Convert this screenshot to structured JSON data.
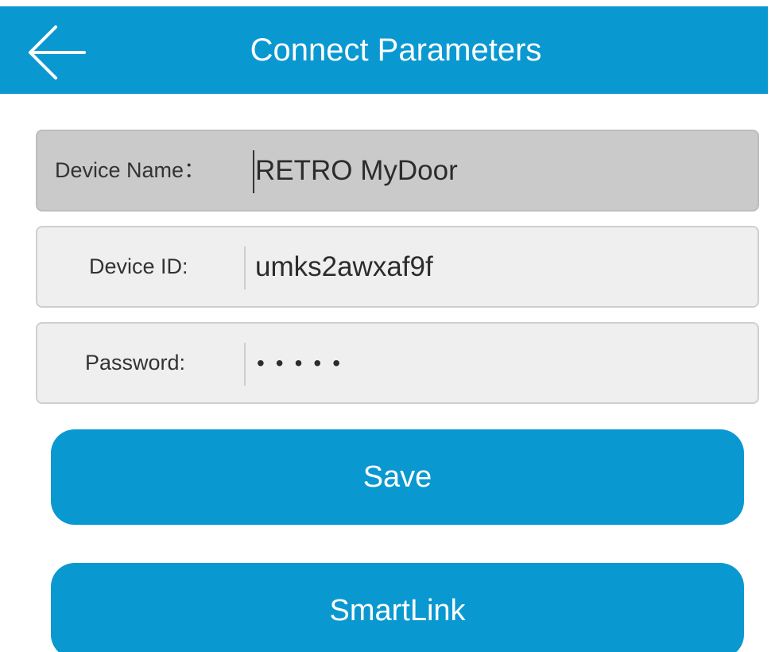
{
  "header": {
    "title": "Connect Parameters",
    "back_icon": "arrow-left-icon",
    "color": "#0a98d1"
  },
  "fields": {
    "device_name": {
      "label": "Device Name：",
      "value": "RETRO MyDoor"
    },
    "device_id": {
      "label": "Device ID:",
      "value": "umks2awxaf9f"
    },
    "password": {
      "label": "Password:",
      "value": "•••••"
    }
  },
  "buttons": {
    "save_label": "Save",
    "smartlink_label": "SmartLink"
  }
}
